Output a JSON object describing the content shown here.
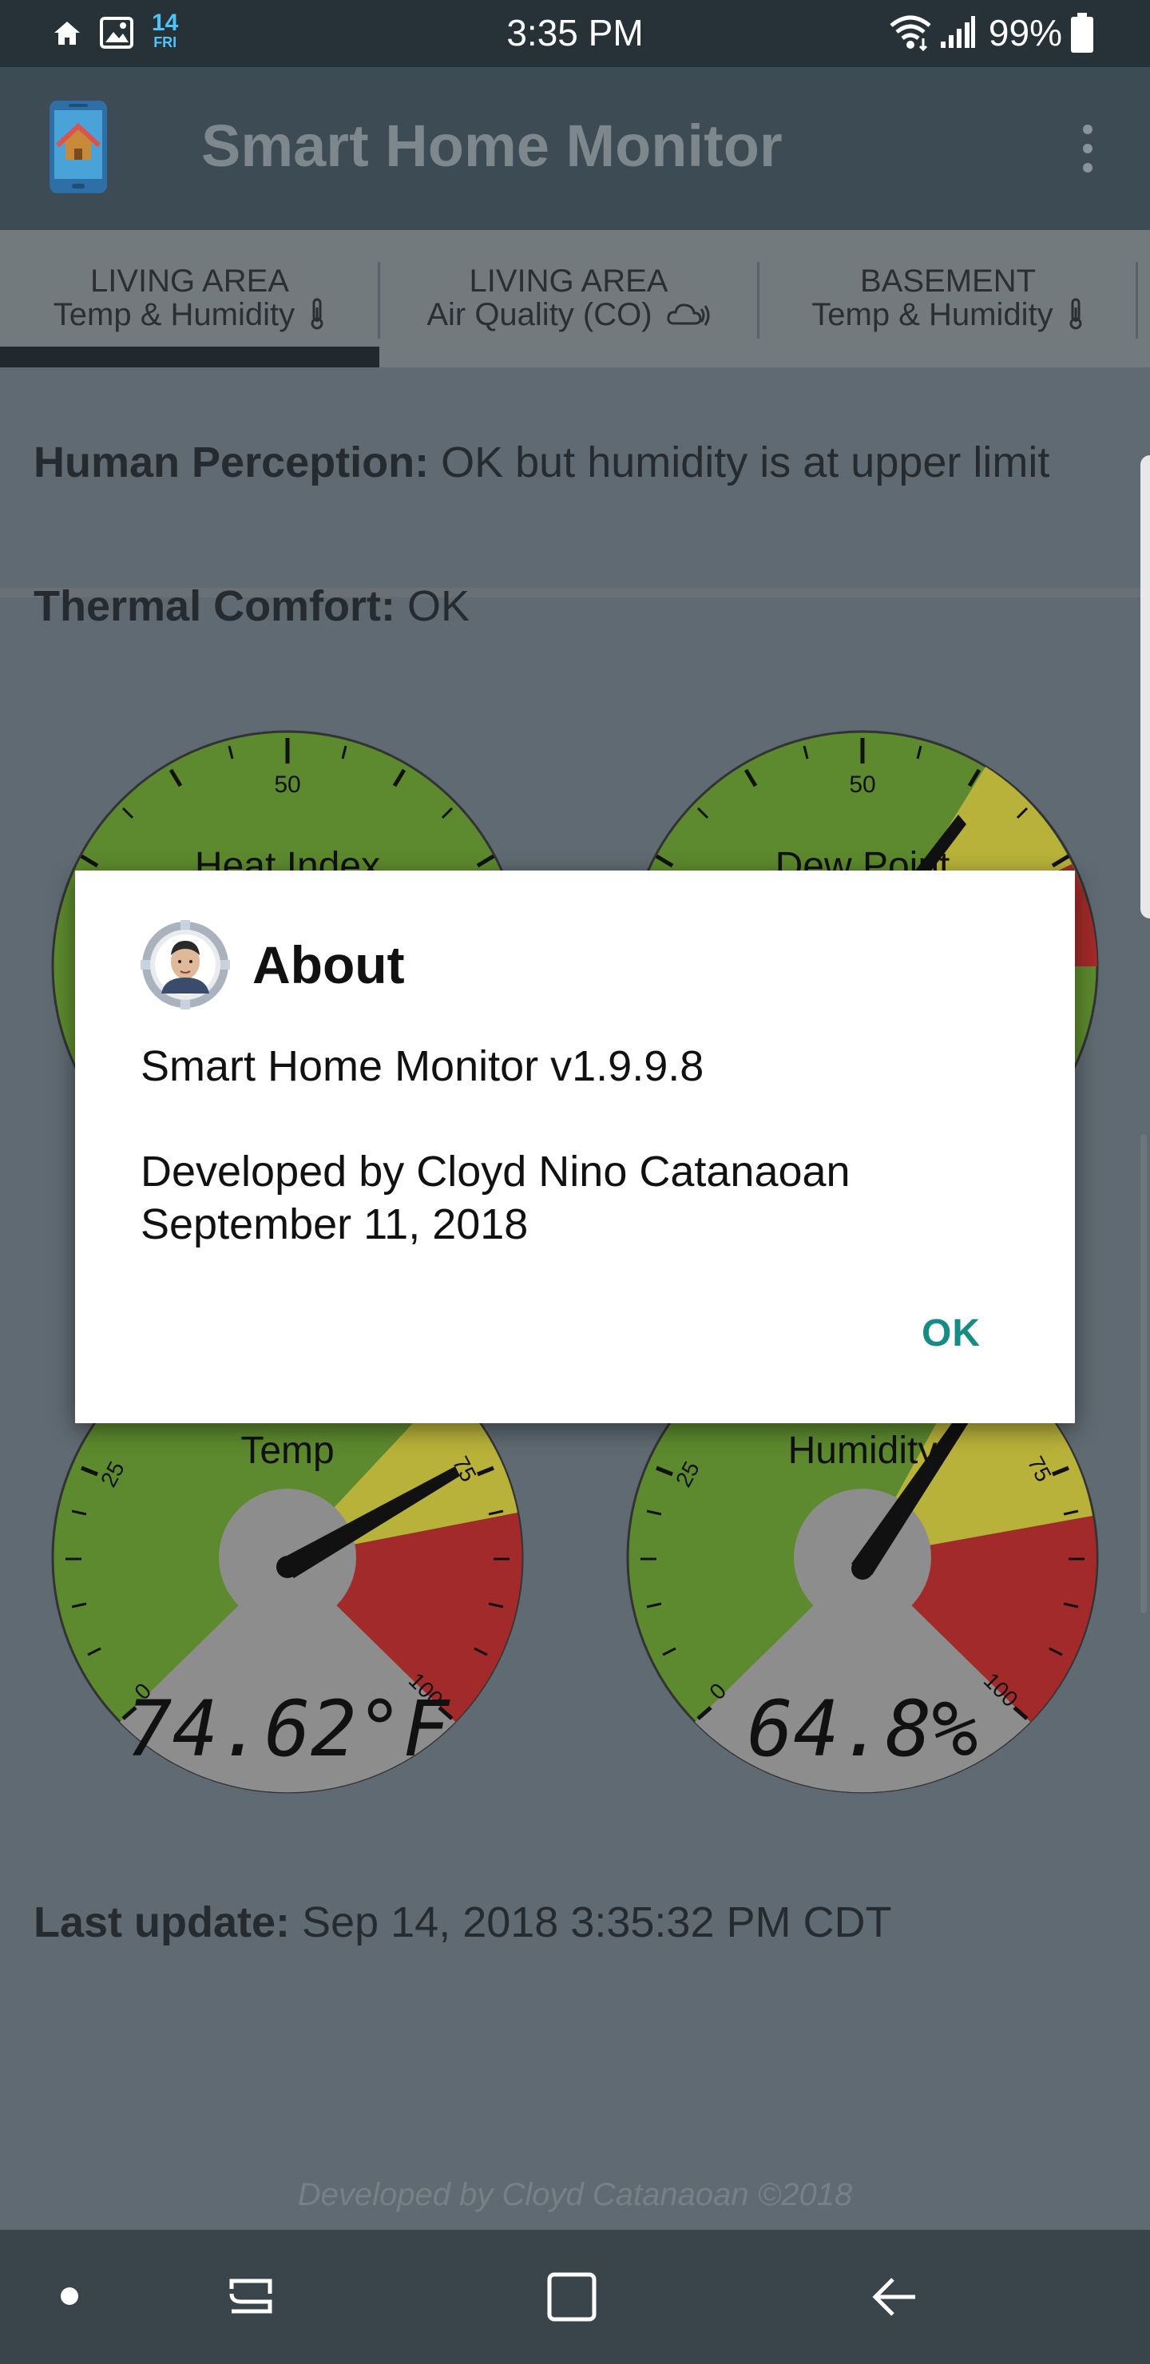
{
  "status_bar": {
    "time": "3:35 PM",
    "battery_percent": "99%",
    "calendar_day": "14",
    "calendar_weekday": "FRI",
    "icons": [
      "home-icon",
      "gallery-icon",
      "calendar-icon",
      "wifi-icon",
      "signal-icon",
      "battery-icon"
    ]
  },
  "app_bar": {
    "title": "Smart Home Monitor",
    "logo_icon": "smart-home-phone-icon",
    "overflow_icon": "more-vert-icon"
  },
  "tabs": [
    {
      "line1": "LIVING AREA",
      "line2": "Temp & Humidity",
      "icon": "thermometer-icon",
      "selected": true
    },
    {
      "line1": "LIVING AREA",
      "line2": "Air Quality (CO)",
      "icon": "cloud-icon",
      "selected": false
    },
    {
      "line1": "BASEMENT",
      "line2": "Temp & Humidity",
      "icon": "thermometer-icon",
      "selected": false
    }
  ],
  "content": {
    "perception_label": "Human Perception:",
    "perception_value": "OK but humidity is at upper limit",
    "comfort_label": "Thermal Comfort:",
    "comfort_value": "OK",
    "gauges": {
      "heat_index": {
        "title": "Heat Index",
        "tick_label": "50"
      },
      "dew_point": {
        "title": "Dew Point",
        "tick_label": "50"
      },
      "temp": {
        "title": "Temp",
        "reading": "74.62°F",
        "value": 74.62,
        "ticks": [
          "0",
          "25",
          "75",
          "100"
        ]
      },
      "humidity": {
        "title": "Humidity",
        "reading": "64.8%",
        "value": 64.8,
        "ticks": [
          "0",
          "25",
          "75",
          "100"
        ]
      }
    },
    "last_update_label": "Last update:",
    "last_update_value": "Sep 14, 2018 3:35:32 PM CDT",
    "footer_credit": "Developed by Cloyd Catanaoan ©2018"
  },
  "dialog": {
    "title": "About",
    "avatar_icon": "developer-avatar-gear-icon",
    "version_line": "Smart Home Monitor v1.9.9.8",
    "developer_line": "Developed by Cloyd Nino Catanaoan",
    "date_line": "September 11, 2018",
    "ok_label": "OK"
  },
  "nav_bar": {
    "icons": [
      "dot-icon",
      "recent-apps-icon",
      "home-square-icon",
      "back-icon"
    ]
  },
  "colors": {
    "status_bar": "#263238",
    "app_bar": "#3d4b55",
    "background": "#5f6a72",
    "dialog_accent": "#158c84",
    "gauge_green": "#5d8a2e",
    "gauge_yellow": "#b9b23a",
    "gauge_red": "#a32a2a"
  }
}
